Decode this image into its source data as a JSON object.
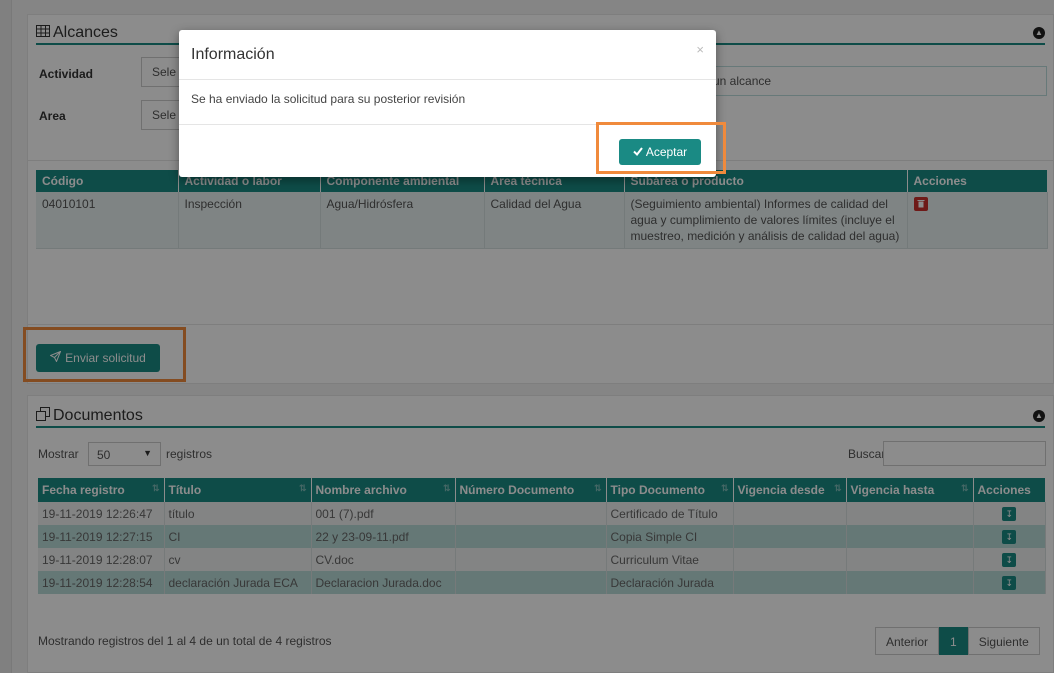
{
  "alcances": {
    "title": "Alcances",
    "actividad_label": "Actividad",
    "actividad_value": "Sele",
    "area_label": "Area",
    "area_value": "Sele",
    "info_text": "ar un alcance",
    "columns": [
      "Código",
      "Actividad o labor",
      "Componente ambiental",
      "Área técnica",
      "Subárea o producto",
      "Acciones"
    ],
    "rows": [
      {
        "codigo": "04010101",
        "actividad": "Inspección",
        "componente": "Agua/Hidrósfera",
        "area": "Calidad del Agua",
        "subarea": "(Seguimiento ambiental) Informes de calidad del agua y cumplimiento de valores límites (incluye el muestreo, medición y análisis de calidad del agua)"
      }
    ],
    "send_label": "Enviar solicitud"
  },
  "documentos": {
    "title": "Documentos",
    "show_label": "Mostrar",
    "page_size": "50",
    "records_label": "registros",
    "search_label": "Buscar:",
    "search_value": "",
    "columns": [
      "Fecha registro",
      "Título",
      "Nombre archivo",
      "Número Documento",
      "Tipo Documento",
      "Vigencia desde",
      "Vigencia hasta",
      "Acciones"
    ],
    "rows": [
      {
        "fecha": "19-11-2019 12:26:47",
        "titulo": "título",
        "archivo": "001 (7).pdf",
        "numero": "",
        "tipo": "Certificado de Título",
        "desde": "",
        "hasta": ""
      },
      {
        "fecha": "19-11-2019 12:27:15",
        "titulo": "CI",
        "archivo": "22 y 23-09-11.pdf",
        "numero": "",
        "tipo": "Copia Simple CI",
        "desde": "",
        "hasta": ""
      },
      {
        "fecha": "19-11-2019 12:28:07",
        "titulo": "cv",
        "archivo": "CV.doc",
        "numero": "",
        "tipo": "Curriculum Vitae",
        "desde": "",
        "hasta": ""
      },
      {
        "fecha": "19-11-2019 12:28:54",
        "titulo": "declaración Jurada ECA",
        "archivo": "Declaracion Jurada.doc",
        "numero": "",
        "tipo": "Declaración Jurada",
        "desde": "",
        "hasta": ""
      }
    ],
    "summary": "Mostrando registros del 1 al 4 de un total de 4 registros",
    "pager": {
      "prev": "Anterior",
      "current": "1",
      "next": "Siguiente"
    }
  },
  "modal": {
    "title": "Información",
    "close": "×",
    "message": "Se ha enviado la solicitud para su posterior revisión",
    "accept_label": "Aceptar"
  },
  "colors": {
    "accent": "#1a8a84",
    "highlight": "#f08a3c",
    "danger": "#c9302c"
  }
}
